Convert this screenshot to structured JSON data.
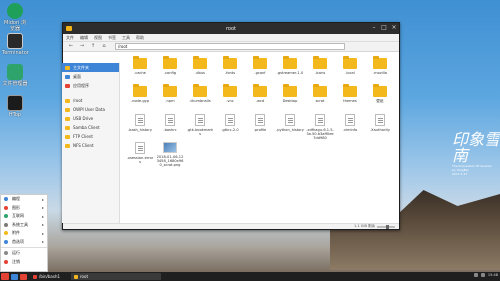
{
  "desktop": {
    "icons": [
      {
        "label": "Midori 浏览器",
        "icon": "midori-globe-icon",
        "color": "#1e9f5a"
      },
      {
        "label": "Terminator",
        "icon": "terminal-icon",
        "color": "#2a2a2a"
      },
      {
        "label": "文件管理器",
        "icon": "file-manager-icon",
        "color": "#2ea36b"
      },
      {
        "label": "HTop",
        "icon": "htop-monitor-icon",
        "color": "#1b1b1b"
      }
    ],
    "wallpaper_text": {
      "calligraphy": "印象雪南",
      "subtitle": "The Impression Of Xuenan",
      "subtitle2": "by YangBai",
      "date": "2017.1.17"
    }
  },
  "window": {
    "title": "root",
    "menu": [
      "文件",
      "编辑",
      "视图",
      "书签",
      "工具",
      "帮助"
    ],
    "toolbar": {
      "back": "←",
      "forward": "→",
      "up": "↑",
      "home": "⌂",
      "path": "/root"
    },
    "sidebar": [
      {
        "label": "主文件夹",
        "icon": "home-folder-icon",
        "color": "#f3b91c",
        "selected": true
      },
      {
        "label": "桌面",
        "icon": "desktop-icon",
        "color": "#3e85d8",
        "selected": false
      },
      {
        "label": "应用程序",
        "icon": "applications-icon",
        "color": "#e34234",
        "selected": false
      },
      {
        "label": "/root",
        "icon": "folder-icon",
        "color": "#f3b91c",
        "selected": false
      },
      {
        "label": "OWPI User Data",
        "icon": "folder-icon",
        "color": "#f3b91c",
        "selected": false
      },
      {
        "label": "USB Drive",
        "icon": "usb-drive-icon",
        "color": "#f3b91c",
        "selected": false
      },
      {
        "label": "Samba Client",
        "icon": "network-folder-icon",
        "color": "#f3b91c",
        "selected": false
      },
      {
        "label": "FTP Client",
        "icon": "ftp-folder-icon",
        "color": "#f3b91c",
        "selected": false
      },
      {
        "label": "NFS Client",
        "icon": "nfs-folder-icon",
        "color": "#f3b91c",
        "selected": false
      }
    ],
    "files": [
      {
        "name": ".cache",
        "kind": "folder"
      },
      {
        "name": ".config",
        "kind": "folder"
      },
      {
        "name": ".dbus",
        "kind": "folder"
      },
      {
        "name": ".fonts",
        "kind": "folder"
      },
      {
        "name": ".gconf",
        "kind": "folder"
      },
      {
        "name": ".gstreamer-1.0",
        "kind": "folder"
      },
      {
        "name": ".icons",
        "kind": "folder"
      },
      {
        "name": ".local",
        "kind": "folder"
      },
      {
        "name": ".mozilla",
        "kind": "folder"
      },
      {
        "name": "",
        "kind": "none"
      },
      {
        "name": ".node-gyp",
        "kind": "folder"
      },
      {
        "name": ".npm",
        "kind": "folder"
      },
      {
        "name": ".thumbnails",
        "kind": "folder"
      },
      {
        "name": ".vnc",
        "kind": "folder"
      },
      {
        "name": ".wcd",
        "kind": "folder"
      },
      {
        "name": "Desktop",
        "kind": "folder"
      },
      {
        "name": "scrot",
        "kind": "folder"
      },
      {
        "name": "themes",
        "kind": "folder"
      },
      {
        "name": "壁纸",
        "kind": "folder"
      },
      {
        "name": "",
        "kind": "none"
      },
      {
        "name": ".bash_history",
        "kind": "doc"
      },
      {
        "name": ".bashrc",
        "kind": "doc"
      },
      {
        "name": ".gtk-bookmarks",
        "kind": "doc"
      },
      {
        "name": ".gtkrc-2.0",
        "kind": "doc"
      },
      {
        "name": ".profile",
        "kind": "doc"
      },
      {
        "name": ".python_history",
        "kind": "doc"
      },
      {
        "name": ".xdfhagu-6.1.5-3a.50.b3aff0ee7dd980",
        "kind": "doc"
      },
      {
        "name": ".viminfo",
        "kind": "doc"
      },
      {
        "name": ".Xauthority",
        "kind": "doc"
      },
      {
        "name": "",
        "kind": "none"
      },
      {
        "name": ".xsession-errors",
        "kind": "doc"
      },
      {
        "name": "2018-01-06-123458_1680x960_scrot.png",
        "kind": "image"
      }
    ],
    "status": {
      "left": "",
      "right": "1.1 GiB 剩余",
      "zoom_fraction": 0.6
    }
  },
  "startmenu": {
    "items": [
      {
        "label": "编程",
        "color": "#3e85d8",
        "submenu": true
      },
      {
        "label": "图形",
        "color": "#e34234",
        "submenu": true
      },
      {
        "label": "互联网",
        "color": "#2ea36b",
        "submenu": true
      },
      {
        "label": "系统工具",
        "color": "#7a7a7a",
        "submenu": true
      },
      {
        "label": "附件",
        "color": "#f3b91c",
        "submenu": true
      },
      {
        "label": "首选项",
        "color": "#3e85d8",
        "submenu": true
      },
      {
        "label": "运行",
        "color": "#888888",
        "submenu": false
      },
      {
        "label": "注销",
        "color": "#e34234",
        "submenu": false
      }
    ]
  },
  "taskbar": {
    "tasks": [
      {
        "label": "/bin/bash1",
        "color": "#e34234",
        "active": false
      },
      {
        "label": "root",
        "color": "#f3b91c",
        "active": true
      }
    ],
    "tray": {
      "time": "15:48"
    }
  }
}
